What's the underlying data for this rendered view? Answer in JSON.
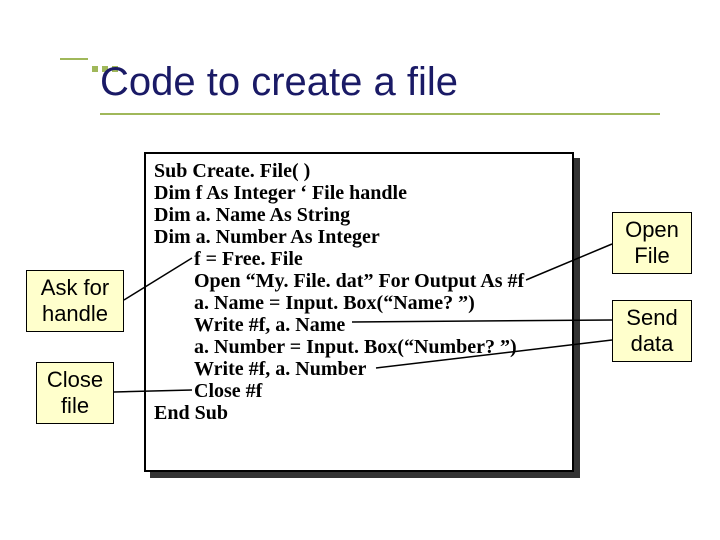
{
  "title": "Code to create a file",
  "code": {
    "l1": "Sub Create. File( )",
    "l2": "Dim f As Integer ‘ File handle",
    "l3": "Dim a. Name As String",
    "l4": "Dim a. Number As Integer",
    "l5": "f = Free. File",
    "l6": "Open “My. File. dat” For Output As #f",
    "l7": "a. Name = Input. Box(“Name? ”)",
    "l8": "Write #f, a. Name",
    "l9": "a. Number = Input. Box(“Number? ”)",
    "l10": "Write #f, a. Number",
    "l11": "Close #f",
    "l12": "End Sub"
  },
  "callouts": {
    "ask_handle_1": "Ask for",
    "ask_handle_2": "handle",
    "close_1": "Close",
    "close_2": "file",
    "open_1": "Open",
    "open_2": "File",
    "send_1": "Send",
    "send_2": "data"
  }
}
